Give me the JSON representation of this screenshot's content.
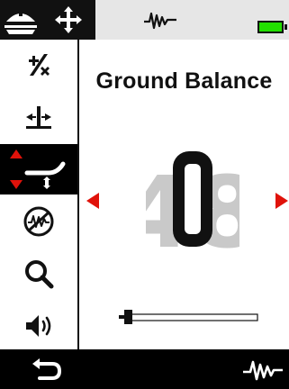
{
  "screen": {
    "title": "Ground Balance",
    "value": "0",
    "ghost_value": "48",
    "slider_fraction": 0.0
  },
  "topbar": {
    "mode_icon": "field-mode-icon",
    "move_icon": "move-arrows-icon",
    "signal_icon": "signal-wave-icon",
    "battery_level_color": "#22e000"
  },
  "sidebar": {
    "items": [
      {
        "icon": "sensitivity-ratio-icon",
        "active": false
      },
      {
        "icon": "threshold-icon",
        "active": false
      },
      {
        "icon": "ground-balance-icon",
        "active": true
      },
      {
        "icon": "noise-cancel-icon",
        "active": false
      },
      {
        "icon": "search-icon",
        "active": false
      },
      {
        "icon": "volume-icon",
        "active": false
      }
    ]
  },
  "bottombar": {
    "back_icon": "back-icon",
    "signal_icon": "signal-wave-icon"
  },
  "colors": {
    "accent": "#e0120a",
    "ink": "#111111",
    "panel": "#e6e6e6"
  }
}
